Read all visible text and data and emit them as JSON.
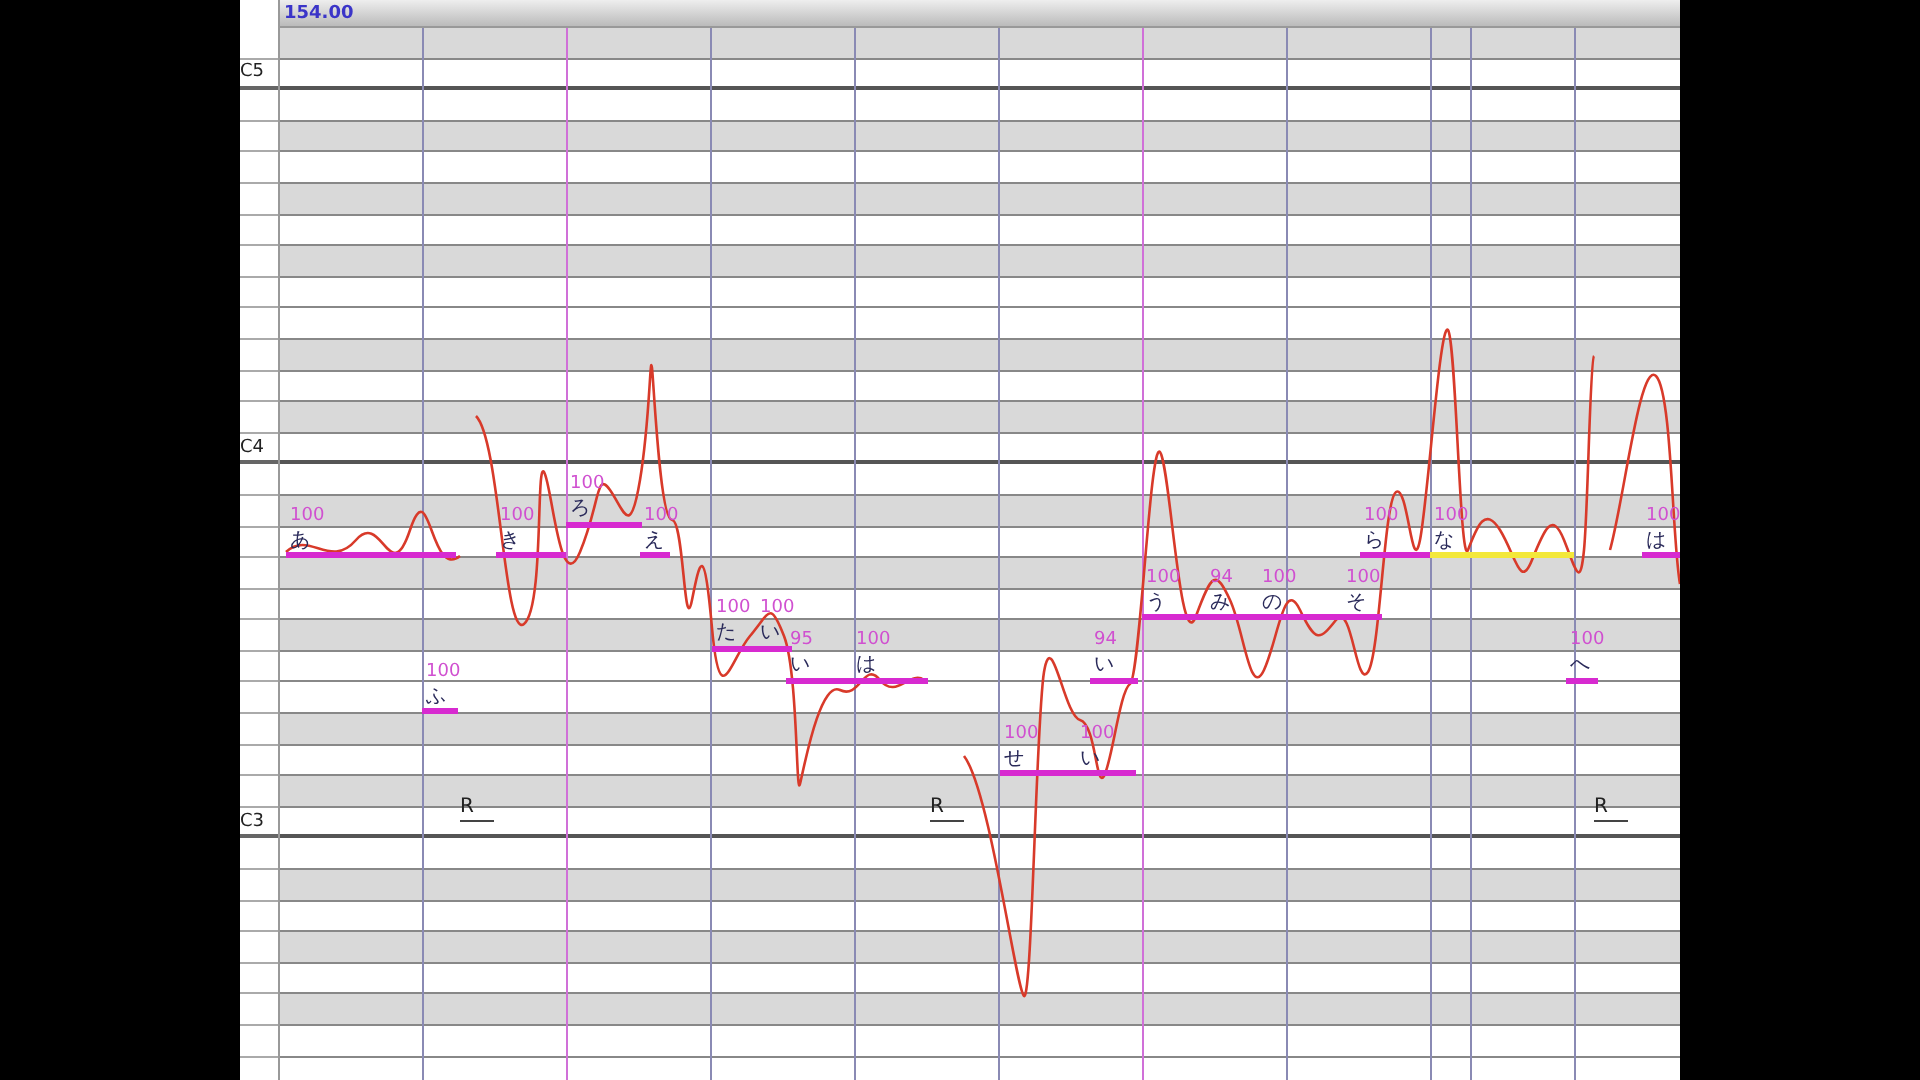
{
  "header": {
    "tempo": "154.00"
  },
  "keys": [
    {
      "label": "C5"
    },
    {
      "label": "C4"
    },
    {
      "label": "C3"
    }
  ],
  "notes": [
    {
      "lyric": "あ",
      "intensity": "100",
      "selected": false
    },
    {
      "lyric": "ふ",
      "intensity": "100",
      "selected": false
    },
    {
      "lyric": "き",
      "intensity": "100",
      "selected": false
    },
    {
      "lyric": "ろ",
      "intensity": "100",
      "selected": false
    },
    {
      "lyric": "え",
      "intensity": "100",
      "selected": false
    },
    {
      "lyric": "た",
      "intensity": "100",
      "selected": false
    },
    {
      "lyric": "い",
      "intensity": "100",
      "selected": false
    },
    {
      "lyric": "い",
      "intensity": "95",
      "selected": false
    },
    {
      "lyric": "は",
      "intensity": "100",
      "selected": false
    },
    {
      "lyric": "せ",
      "intensity": "100",
      "selected": false
    },
    {
      "lyric": "い",
      "intensity": "100",
      "selected": false
    },
    {
      "lyric": "い",
      "intensity": "94",
      "selected": false
    },
    {
      "lyric": "う",
      "intensity": "100",
      "selected": false
    },
    {
      "lyric": "み",
      "intensity": "94",
      "selected": false
    },
    {
      "lyric": "の",
      "intensity": "100",
      "selected": false
    },
    {
      "lyric": "そ",
      "intensity": "100",
      "selected": false
    },
    {
      "lyric": "ら",
      "intensity": "100",
      "selected": false
    },
    {
      "lyric": "な",
      "intensity": "100",
      "selected": true
    },
    {
      "lyric": "へ",
      "intensity": "100",
      "selected": false
    },
    {
      "lyric": "は",
      "intensity": "100",
      "selected": false
    }
  ],
  "rests": [
    {
      "label": "R"
    },
    {
      "label": "R"
    },
    {
      "label": "R"
    }
  ]
}
